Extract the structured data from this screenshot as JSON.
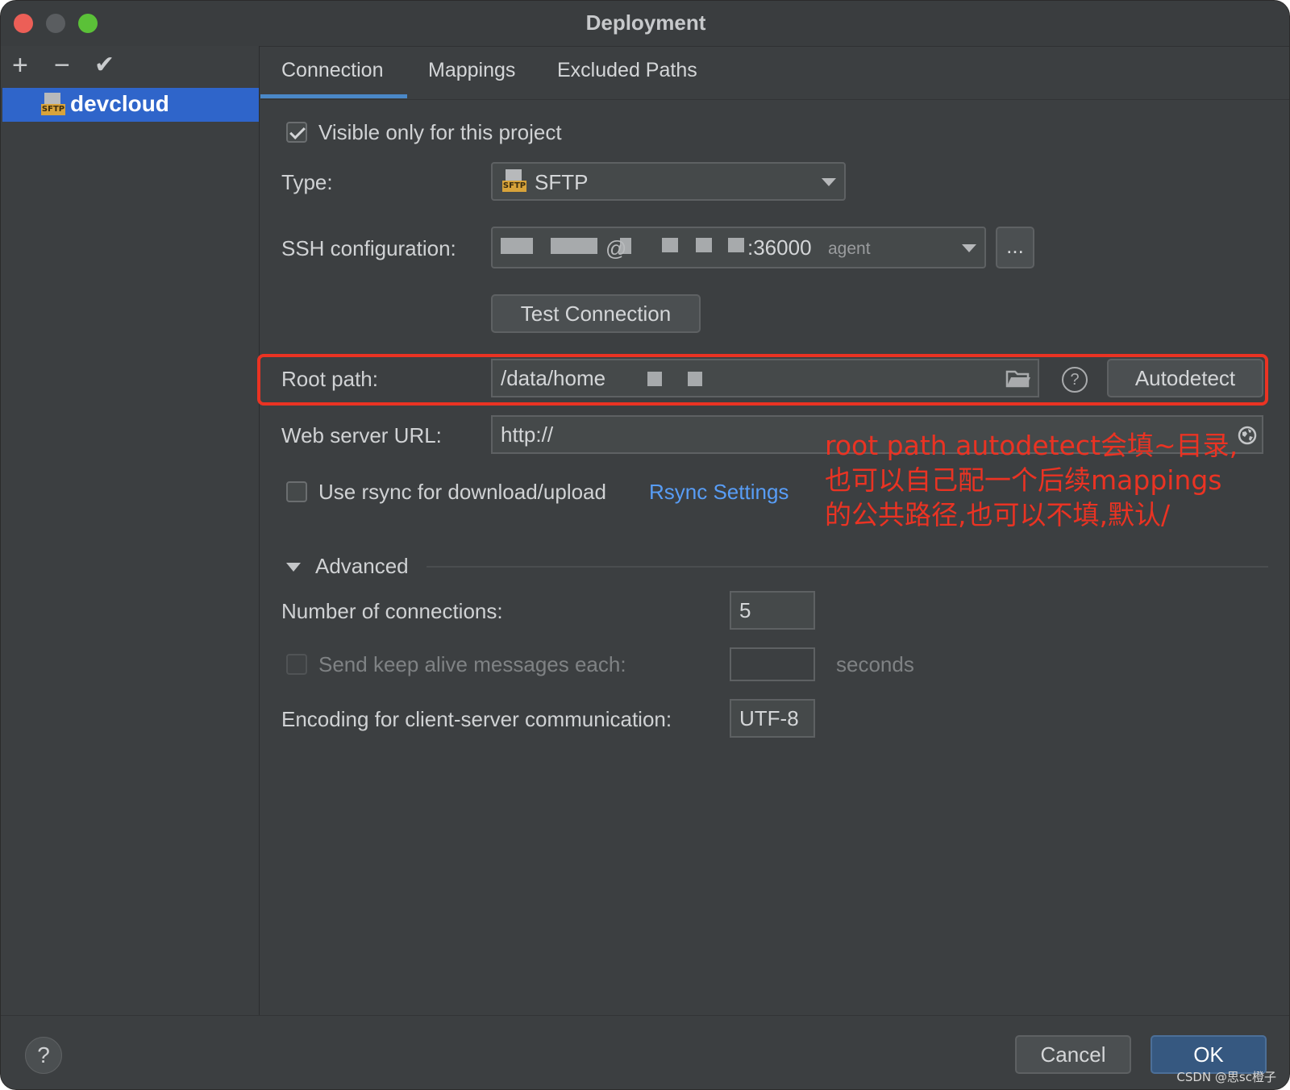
{
  "window": {
    "title": "Deployment"
  },
  "sidebar": {
    "toolbar": {
      "add": "+",
      "remove": "−",
      "confirm": "✔"
    },
    "items": [
      {
        "label": "devcloud",
        "icon": "sftp-icon",
        "icon_text": "SFTP",
        "selected": true
      }
    ]
  },
  "tabs": [
    {
      "label": "Connection",
      "active": true
    },
    {
      "label": "Mappings",
      "active": false
    },
    {
      "label": "Excluded Paths",
      "active": false
    }
  ],
  "connection": {
    "visible_only": {
      "label": "Visible only for this project",
      "checked": true
    },
    "type": {
      "label": "Type:",
      "value": "SFTP",
      "icon_text": "SFTP"
    },
    "ssh": {
      "label": "SSH configuration:",
      "at": "@",
      "port": ":36000",
      "suffix": "agent",
      "more": "..."
    },
    "test_connection": "Test Connection",
    "root_path": {
      "label": "Root path:",
      "value": "/data/home",
      "autodetect": "Autodetect",
      "help": "?"
    },
    "web_server_url": {
      "label": "Web server URL:",
      "value": "http://"
    },
    "rsync": {
      "label": "Use rsync for download/upload",
      "checked": false,
      "link": "Rsync Settings"
    }
  },
  "advanced": {
    "title": "Advanced",
    "connections": {
      "label": "Number of connections:",
      "value": "5"
    },
    "keep_alive": {
      "label": "Send keep alive messages each:",
      "value": "",
      "unit": "seconds",
      "enabled": false
    },
    "encoding": {
      "label": "Encoding for client-server communication:",
      "value": "UTF-8"
    }
  },
  "annotation": {
    "lines": [
      "root path autodetect会填~目录,",
      "也可以自己配一个后续mappings",
      "的公共路径,也可以不填,默认/"
    ],
    "color": "#ea3323"
  },
  "footer": {
    "help": "?",
    "cancel": "Cancel",
    "ok": "OK"
  },
  "watermark": "CSDN @思sc橙子",
  "colors": {
    "accent": "#2f65ca",
    "link": "#589df6",
    "ok_button": "#365880"
  }
}
